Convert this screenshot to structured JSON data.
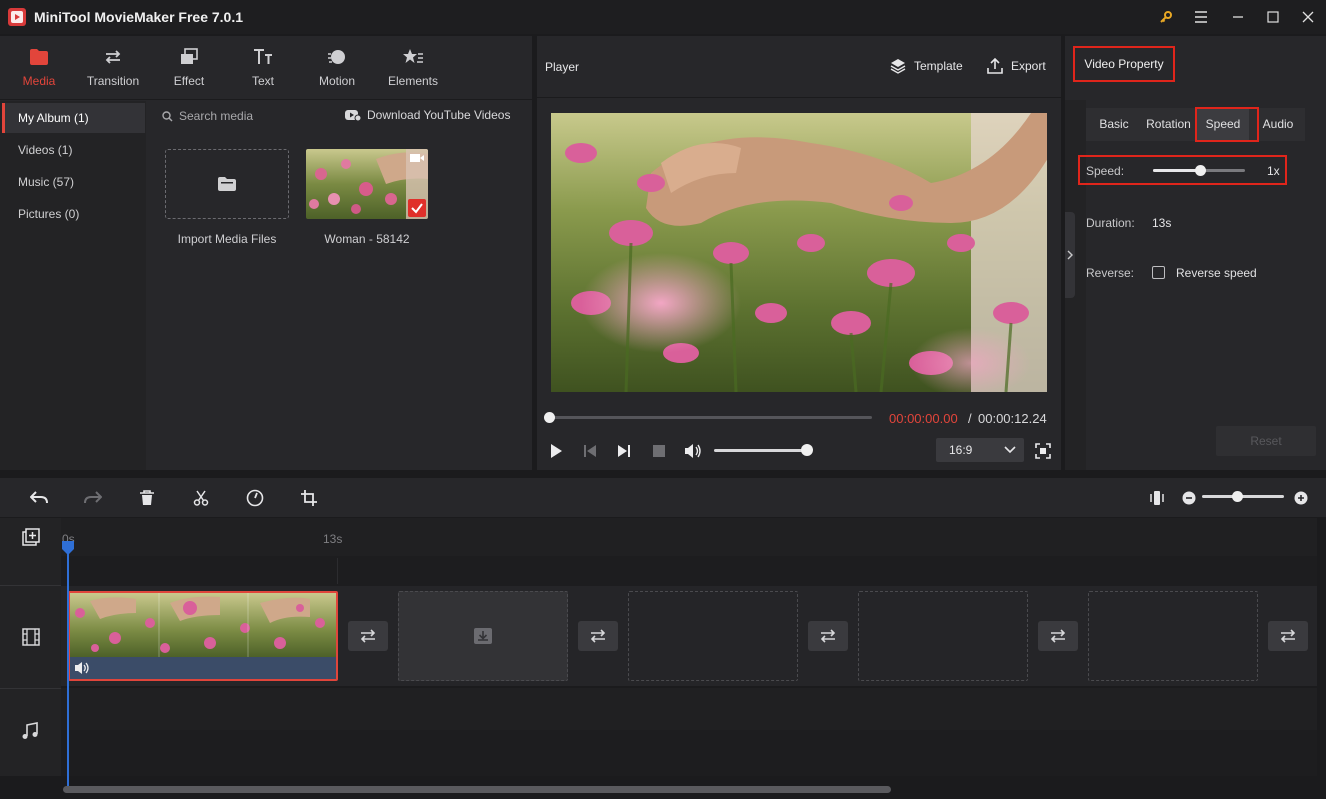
{
  "app": {
    "title": "MiniTool MovieMaker Free 7.0.1"
  },
  "toolbar": {
    "tabs": [
      {
        "label": "Media",
        "icon": "folder-icon",
        "active": true
      },
      {
        "label": "Transition",
        "icon": "swap-arrows-icon"
      },
      {
        "label": "Effect",
        "icon": "layers-icon"
      },
      {
        "label": "Text",
        "icon": "text-icon"
      },
      {
        "label": "Motion",
        "icon": "motion-icon"
      },
      {
        "label": "Elements",
        "icon": "elements-icon"
      }
    ]
  },
  "album": {
    "items": [
      {
        "label": "My Album (1)",
        "active": true
      },
      {
        "label": "Videos (1)"
      },
      {
        "label": "Music (57)"
      },
      {
        "label": "Pictures (0)"
      }
    ]
  },
  "media": {
    "search_placeholder": "Search media",
    "download_label": "Download YouTube Videos",
    "import_label": "Import Media Files",
    "items": [
      {
        "label": "Woman - 58142"
      }
    ]
  },
  "player": {
    "title": "Player",
    "template_label": "Template",
    "export_label": "Export",
    "time_current": "00:00:00.00",
    "time_separator": "/",
    "time_total": "00:00:12.24",
    "progress": 0,
    "volume": 1.0,
    "aspect_ratio": "16:9"
  },
  "property": {
    "title": "Video Property",
    "tabs": [
      "Basic",
      "Rotation",
      "Speed",
      "Audio"
    ],
    "active_tab": "Speed",
    "speed_label": "Speed:",
    "speed_value": "1x",
    "speed_level": 0.52,
    "duration_label": "Duration:",
    "duration_value": "13s",
    "reverse_label": "Reverse:",
    "reverse_text": "Reverse speed",
    "reset_label": "Reset"
  },
  "timeline": {
    "ruler": [
      "0s",
      "13s"
    ],
    "zoom_level": 0.4
  },
  "colors": {
    "accent": "#e2453b",
    "highlight_box": "#e0251b",
    "playhead": "#2f6fd6",
    "background": "#1b1b1d",
    "panel": "#27272a"
  }
}
